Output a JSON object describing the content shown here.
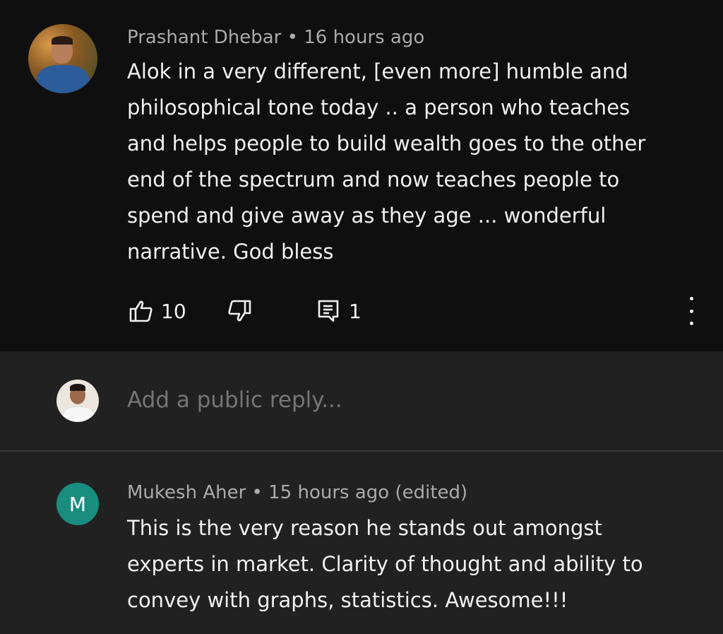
{
  "comment1": {
    "author": "Prashant Dhebar",
    "separator": "•",
    "time": "16 hours ago",
    "lines": [
      "Alok in a very different, [even more] humble and",
      "philosophical tone today .. a person who teaches",
      "and helps people to build wealth goes to the other",
      "end of the spectrum and now teaches people to",
      "spend and give away as they age ... wonderful",
      "narrative. God bless"
    ],
    "likes": "10",
    "replies": "1",
    "icons": {
      "like": "thumbs-up-icon",
      "dislike": "thumbs-down-icon",
      "reply": "reply-icon",
      "more": "more-vert-icon"
    }
  },
  "reply": {
    "placeholder": "Add a public reply..."
  },
  "comment2": {
    "avatar_letter": "M",
    "avatar_color": "#1a8e7e",
    "author": "Mukesh Aher",
    "separator": "•",
    "time": "15 hours ago (edited)",
    "lines": [
      "This is the very reason he stands out amongst",
      "experts in market. Clarity of thought and ability to",
      "convey with graphs, statistics. Awesome!!!"
    ]
  },
  "colors": {
    "top_background": "#0f0f0f",
    "background": "#212121",
    "text": "#f1f1f1",
    "secondary_text": "#aaaaaa"
  }
}
